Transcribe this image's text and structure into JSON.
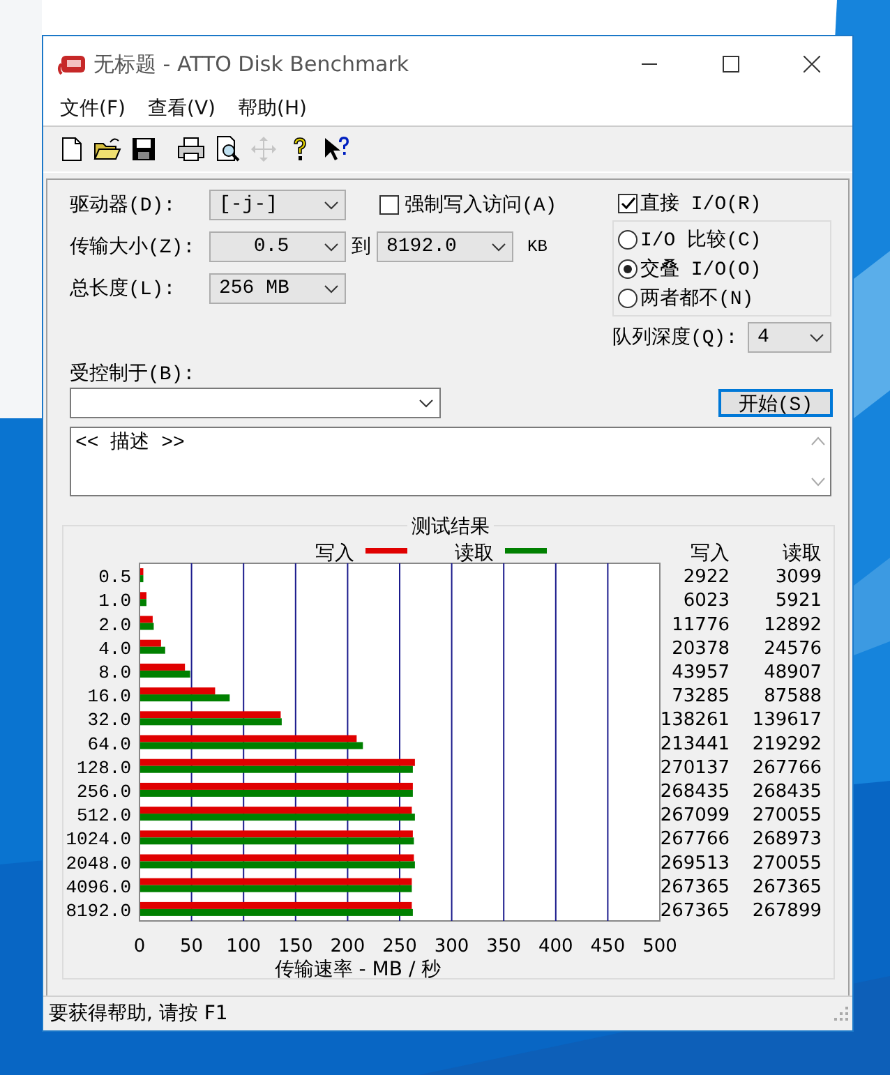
{
  "window": {
    "title": "无标题 - ATTO Disk Benchmark"
  },
  "menu": [
    {
      "label": "文件(F)"
    },
    {
      "label": "查看(V)"
    },
    {
      "label": "帮助(H)"
    }
  ],
  "toolbar": [
    {
      "kind": "new"
    },
    {
      "kind": "open"
    },
    {
      "kind": "save"
    },
    {
      "kind": "print"
    },
    {
      "kind": "preview"
    },
    {
      "kind": "move",
      "disabled": true
    },
    {
      "kind": "help"
    },
    {
      "kind": "context-help"
    }
  ],
  "form": {
    "drive": {
      "label": "驱动器(D):",
      "value": "[-j-]"
    },
    "force_write": {
      "label": "强制写入访问(A)",
      "checked": false
    },
    "transfer_size": {
      "label": "传输大小(Z):",
      "from": "0.5",
      "to_label": "到",
      "to": "8192.0",
      "unit": "KB"
    },
    "total_length": {
      "label": "总长度(L):",
      "value": "256 MB"
    },
    "direct_io": {
      "label": "直接 I/O(R)",
      "checked": true
    },
    "io_mode": [
      {
        "label": "I/O 比较(C)",
        "selected": false
      },
      {
        "label": "交叠 I/O(O)",
        "selected": true
      },
      {
        "label": "两者都不(N)",
        "selected": false
      }
    ],
    "queue_depth": {
      "label": "队列深度(Q):",
      "value": "4"
    },
    "controlled_by": {
      "label": "受控制于(B):"
    },
    "start_button": "开始(S)",
    "description": "<< 描述 >>"
  },
  "results": {
    "title": "测试结果",
    "columns": [
      "写入",
      "读取"
    ],
    "rows": [
      {
        "write": "2922",
        "read": "3099"
      },
      {
        "write": "6023",
        "read": "5921"
      },
      {
        "write": "11776",
        "read": "12892"
      },
      {
        "write": "20378",
        "read": "24576"
      },
      {
        "write": "43957",
        "read": "48907"
      },
      {
        "write": "73285",
        "read": "87588"
      },
      {
        "write": "138261",
        "read": "139617"
      },
      {
        "write": "213441",
        "read": "219292"
      },
      {
        "write": "270137",
        "read": "267766"
      },
      {
        "write": "268435",
        "read": "268435"
      },
      {
        "write": "267099",
        "read": "270055"
      },
      {
        "write": "267766",
        "read": "268973"
      },
      {
        "write": "269513",
        "read": "270055"
      },
      {
        "write": "267365",
        "read": "267365"
      },
      {
        "write": "267365",
        "read": "267899"
      }
    ],
    "chart_data": {
      "type": "bar",
      "orientation": "horizontal",
      "xlabel": "传输速率 - MB / 秒",
      "categories": [
        "0.5",
        "1.0",
        "2.0",
        "4.0",
        "8.0",
        "16.0",
        "32.0",
        "64.0",
        "128.0",
        "256.0",
        "512.0",
        "1024.0",
        "2048.0",
        "4096.0",
        "8192.0"
      ],
      "series": [
        {
          "name": "写入",
          "color": "#e00000",
          "values": [
            3,
            6,
            12,
            20,
            43,
            72,
            135,
            208,
            264,
            262,
            261,
            262,
            263,
            261,
            261
          ]
        },
        {
          "name": "读取",
          "color": "#008000",
          "values": [
            3,
            6,
            13,
            24,
            48,
            86,
            136,
            214,
            262,
            262,
            264,
            263,
            264,
            261,
            262
          ]
        }
      ],
      "xlim": [
        0,
        500
      ],
      "grid": {
        "x": true
      },
      "legend": "top",
      "xticks": [
        0,
        50,
        100,
        150,
        200,
        250,
        300,
        350,
        400,
        450,
        500
      ]
    }
  },
  "status_bar": {
    "text": "要获得帮助, 请按 F1"
  }
}
